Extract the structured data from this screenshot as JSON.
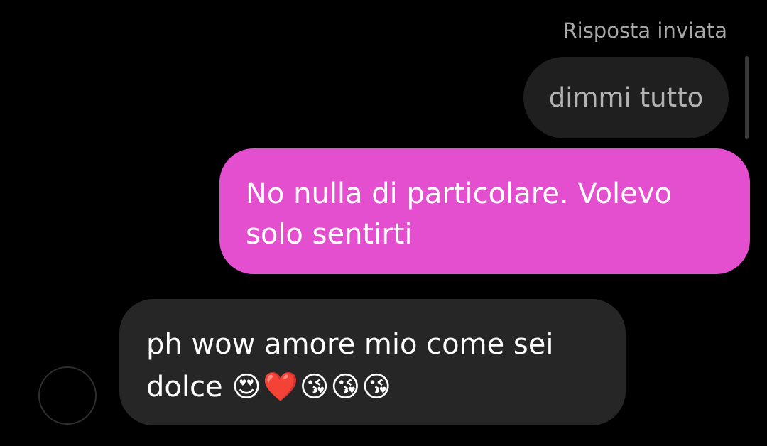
{
  "reply_status": "Risposta inviata",
  "quoted_message": {
    "text": "dimmi tutto"
  },
  "sent_message": {
    "text": "No nulla di particolare. Volevo solo sentirti",
    "bubble_color": "#e44fd0"
  },
  "received_message": {
    "text": "ph wow amore mio come sei dolce",
    "emojis": "😍❤️😘😘😘",
    "bubble_color": "#262626"
  },
  "avatar": {
    "icon": "avatar-placeholder-icon"
  }
}
